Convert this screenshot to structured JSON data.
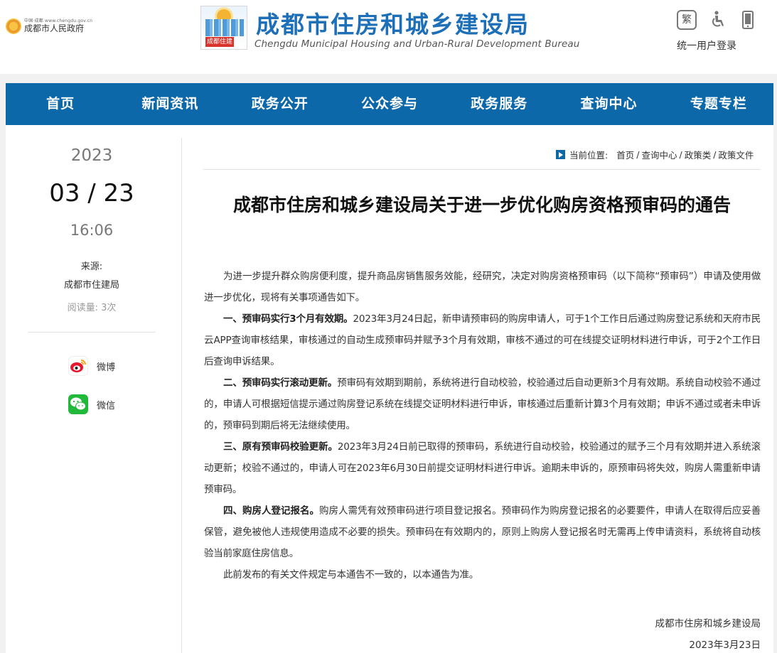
{
  "header": {
    "gov_small": "中国·成都 www.chengdu.gov.cn",
    "gov_name": "成都市人民政府",
    "bureau_logo_tag": "成都住建",
    "bureau_title": "成都市住房和城乡建设局",
    "bureau_subtitle": "Chengdu Municipal Housing and Urban-Rural Development Bureau",
    "tools": {
      "traditional": "繁",
      "accessibility_icon": "accessibility-icon",
      "mobile_icon": "mobile-icon"
    },
    "login": "统一用户登录"
  },
  "nav": {
    "items": [
      "首页",
      "新闻资讯",
      "政务公开",
      "公众参与",
      "政务服务",
      "查询中心",
      "专题专栏"
    ]
  },
  "sidebar": {
    "year": "2023",
    "month_day": "03 / 23",
    "time": "16:06",
    "source_label": "来源:",
    "source_name": "成都市住建局",
    "read_count": "阅读量:  3次",
    "share": {
      "weibo": "微博",
      "wechat": "微信"
    }
  },
  "breadcrumb": {
    "label": "当前位置:",
    "items": [
      "首页",
      "查询中心",
      "政策类",
      "政策文件"
    ]
  },
  "article": {
    "title": "成都市住房和城乡建设局关于进一步优化购房资格预审码的通告",
    "intro": "为进一步提升群众购房便利度，提升商品房销售服务效能，经研究，决定对购房资格预审码（以下简称“预审码”）申请及使用做进一步优化，现将有关事项通告如下。",
    "sections": [
      {
        "heading": "一、预审码实行3个月有效期。",
        "text": "2023年3月24日起，新申请预审码的购房申请人，可于1个工作日后通过购房登记系统和天府市民云APP查询审核结果，审核通过的自动生成预审码并赋予3个月有效期，审核不通过的可在线提交证明材料进行申诉，可于2个工作日后查询申诉结果。"
      },
      {
        "heading": "二、预审码实行滚动更新。",
        "text": "预审码有效期到期前，系统将进行自动校验，校验通过后自动更新3个月有效期。系统自动校验不通过的，申请人可根据短信提示通过购房登记系统在线提交证明材料进行申诉，审核通过后重新计算3个月有效期；申诉不通过或者未申诉的，预审码到期后将无法继续使用。"
      },
      {
        "heading": "三、原有预审码校验更新。",
        "text": "2023年3月24日前已取得的预审码，系统进行自动校验，校验通过的赋予三个月有效期并进入系统滚动更新；校验不通过的，申请人可在2023年6月30日前提交证明材料进行申诉。逾期未申诉的，原预审码将失效，购房人需重新申请预审码。"
      },
      {
        "heading": "四、购房人登记报名。",
        "text": "购房人需凭有效预审码进行项目登记报名。预审码作为购房登记报名的必要要件，申请人在取得后应妥善保管，避免被他人违规使用造成不必要的损失。预审码在有效期内的，原则上购房人登记报名时无需再上传申请资料，系统将自动核验当前家庭住房信息。"
      }
    ],
    "closing": "此前发布的有关文件规定与本通告不一致的，以本通告为准。",
    "signature_org": "成都市住房和城乡建设局",
    "signature_date": "2023年3月23日"
  }
}
